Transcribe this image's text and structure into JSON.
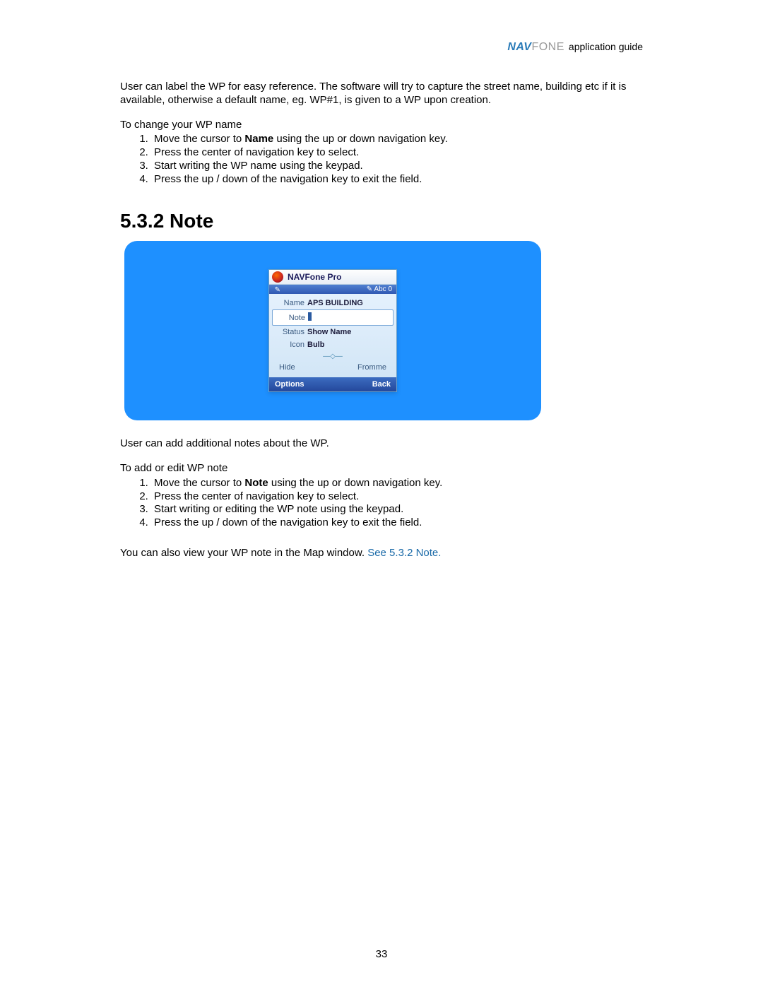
{
  "header": {
    "logo_nav": "NAV",
    "logo_fone": "FONE",
    "app_guide": "application guide"
  },
  "intro": {
    "text": "User can label the WP for easy reference. The software will try to capture the street name, building etc if it is available, otherwise a default name, eg. WP#1, is given to a WP upon creation."
  },
  "change_section": {
    "lead": "To change your WP name",
    "steps": {
      "s1_pre": "Move the cursor to ",
      "s1_bold": "Name",
      "s1_post": " using the up or down navigation key.",
      "s2": "Press the center of navigation key to select.",
      "s3": "Start writing the WP name using the keypad.",
      "s4": "Press the up / down of the navigation key to exit the field."
    }
  },
  "heading": "5.3.2 Note",
  "phone": {
    "title": "NAVFone Pro",
    "input_mode": "Abc",
    "battery": "0",
    "rows": {
      "name_label": "Name",
      "name_value": "APS BUILDING",
      "note_label": "Note",
      "note_value": "",
      "status_label": "Status",
      "status_value": "Show Name",
      "icon_label": "Icon",
      "icon_value": "Bulb"
    },
    "hide": "Hide",
    "fromme": "Fromme",
    "sk_left": "Options",
    "sk_right": "Back"
  },
  "after": {
    "p1": "User can add additional notes about the WP.",
    "lead": "To add or edit WP note",
    "steps": {
      "s1_pre": "Move the cursor to ",
      "s1_bold": "Note",
      "s1_post": " using the up or down navigation key.",
      "s2": "Press the center of navigation key to select.",
      "s3": "Start writing or editing the WP note using the keypad.",
      "s4": "Press the up / down of the navigation key to exit the field."
    },
    "closing_pre": "You can also view your WP note in the Map window. ",
    "closing_link": "See 5.3.2 Note."
  },
  "page_number": "33"
}
